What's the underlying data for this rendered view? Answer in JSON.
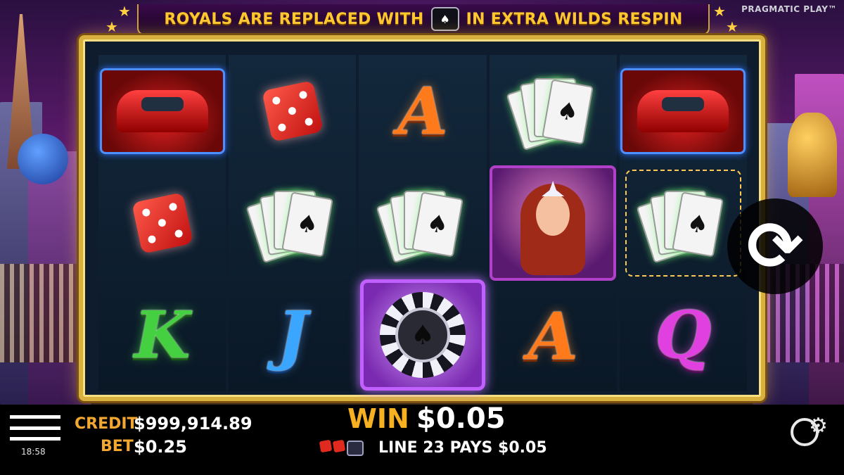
{
  "header": {
    "banner_left": "ROYALS ARE REPLACED WITH",
    "banner_right": "IN EXTRA WILDS RESPIN",
    "brand": "PRAGMATIC PLAY™"
  },
  "reels": [
    [
      "car",
      "dice",
      "K"
    ],
    [
      "dice",
      "cards",
      "J"
    ],
    [
      "A",
      "cards",
      "wild-chip"
    ],
    [
      "cards",
      "lady",
      "A"
    ],
    [
      "car",
      "cards",
      "Q"
    ]
  ],
  "footer": {
    "credit_label": "CREDIT",
    "credit_value": "$999,914.89",
    "bet_label": "BET",
    "bet_value": "$0.25",
    "win_label": "WIN",
    "win_value": "$0.05",
    "line_pays": "LINE 23 PAYS $0.05",
    "clock": "18:58"
  },
  "icons": {
    "menu": "menu-icon",
    "respin": "respin-arrows-icon",
    "settings": "settings-gear-icon"
  },
  "colors": {
    "banner_text": "#ffc830",
    "label_orange": "#f2a830",
    "frame_gold": "#d8b040"
  }
}
